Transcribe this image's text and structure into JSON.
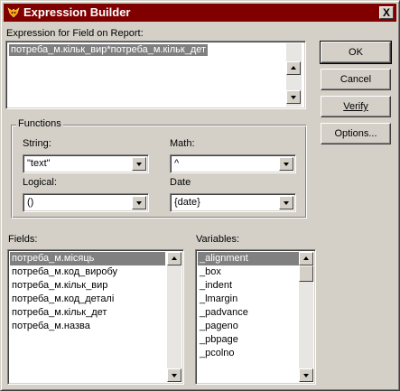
{
  "window": {
    "title": "Expression Builder",
    "close_label": "X",
    "icon": "fox-app-icon"
  },
  "expression": {
    "label": "Expression for Field on Report:",
    "value": "потреба_м.кільк_вир*потреба_м.кільк_дет"
  },
  "buttons": {
    "ok": "OK",
    "cancel": "Cancel",
    "verify": "Verify",
    "options": "Options..."
  },
  "functions": {
    "title": "Functions",
    "string_label": "String:",
    "string_value": "\"text\"",
    "math_label": "Math:",
    "math_value": "^",
    "logical_label": "Logical:",
    "logical_value": "()",
    "date_label": "Date",
    "date_value": "{date}"
  },
  "fields": {
    "label": "Fields:",
    "items": [
      "потреба_м.місяць",
      "потреба_м.код_виробу",
      "потреба_м.кільк_вир",
      "потреба_м.код_деталі",
      "потреба_м.кільк_дет",
      "потреба_м.назва"
    ],
    "selected_index": 0
  },
  "variables": {
    "label": "Variables:",
    "items": [
      {
        "name": "_alignment",
        "type": "C"
      },
      {
        "name": "_box",
        "type": "L"
      },
      {
        "name": "_indent",
        "type": "N"
      },
      {
        "name": "_lmargin",
        "type": "N"
      },
      {
        "name": "_padvance",
        "type": "C"
      },
      {
        "name": "_pageno",
        "type": "N"
      },
      {
        "name": "_pbpage",
        "type": "N"
      },
      {
        "name": "_pcolno",
        "type": "N"
      }
    ],
    "selected_index": 0
  }
}
